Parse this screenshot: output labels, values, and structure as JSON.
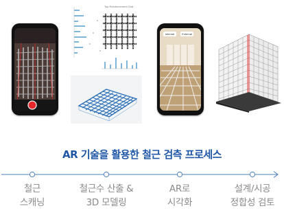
{
  "heading": "AR 기술을 활용한 철근 검측 프로세스",
  "figures": {
    "plot_title": "Top Reinforcement Grid",
    "phone_buttons": [
      "Internal",
      "External"
    ]
  },
  "steps": [
    {
      "line1": "철근",
      "line2": "스캐닝"
    },
    {
      "line1": "철근수 산출 &",
      "line2": "3D 모델링"
    },
    {
      "line1": "AR로",
      "line2": "시각화"
    },
    {
      "line1": "설계/시공",
      "line2": "정합성 검토"
    }
  ],
  "colors": {
    "accent": "#1f57a6",
    "timeline": "#4a7cc0",
    "step_text": "#8a8a8a"
  }
}
